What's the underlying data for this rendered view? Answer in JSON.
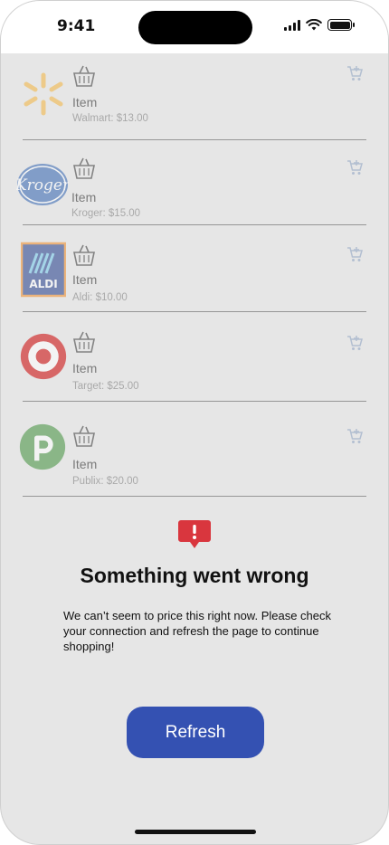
{
  "status_bar": {
    "time": "9:41"
  },
  "stores": [
    {
      "item_label": "Item",
      "price_text": "Walmart: $13.00",
      "logo": "walmart-logo",
      "logo_color": "#f2b33d"
    },
    {
      "item_label": "Item",
      "price_text": "Kroger: $15.00",
      "logo": "kroger-logo",
      "logo_color": "#2f63b1"
    },
    {
      "item_label": "Item",
      "price_text": "Aldi: $10.00",
      "logo": "aldi-logo",
      "logo_color": "#1f3a8a"
    },
    {
      "item_label": "Item",
      "price_text": "Target: $25.00",
      "logo": "target-logo",
      "logo_color": "#cc0000"
    },
    {
      "item_label": "Item",
      "price_text": "Publix: $20.00",
      "logo": "publix-logo",
      "logo_color": "#3f8f3a"
    }
  ],
  "error": {
    "icon": "alert-icon",
    "title": "Something went wrong",
    "message": "We can’t seem to price this right now. Please check your connection and refresh the page to continue shopping!",
    "button_label": "Refresh"
  },
  "colors": {
    "accent": "#3451b2",
    "alert": "#d9363e"
  }
}
